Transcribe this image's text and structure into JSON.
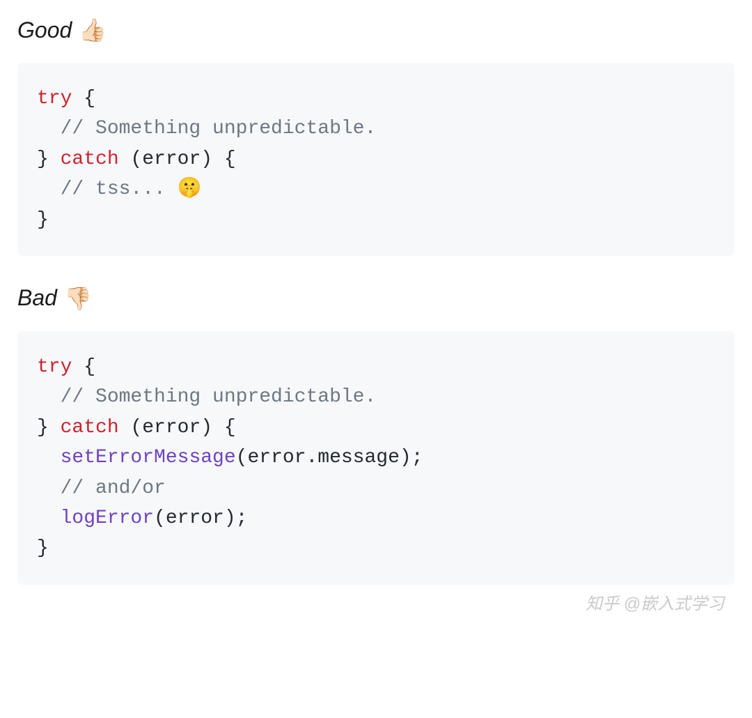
{
  "sections": {
    "good": {
      "label": "Good",
      "emoji": "👍🏻",
      "code": {
        "try_kw": "try",
        "brace_open": " {",
        "comment1": "  // Something unpredictable.",
        "catch_line_close_brace": "} ",
        "catch_kw": "catch",
        "catch_params": " (error) {",
        "comment2_prefix": "  // tss... ",
        "comment2_emoji": "🤫",
        "brace_close": "}"
      }
    },
    "bad": {
      "label": "Bad",
      "emoji": "👎🏻",
      "code": {
        "try_kw": "try",
        "brace_open": " {",
        "comment1": "  // Something unpredictable.",
        "catch_line_close_brace": "} ",
        "catch_kw": "catch",
        "catch_params": " (error) {",
        "indent": "  ",
        "fn1": "setErrorMessage",
        "fn1_args": "(error.message);",
        "comment2": "  // and/or",
        "fn2": "logError",
        "fn2_args": "(error);",
        "brace_close": "}"
      }
    }
  },
  "watermark": "知乎 @嵌入式学习"
}
